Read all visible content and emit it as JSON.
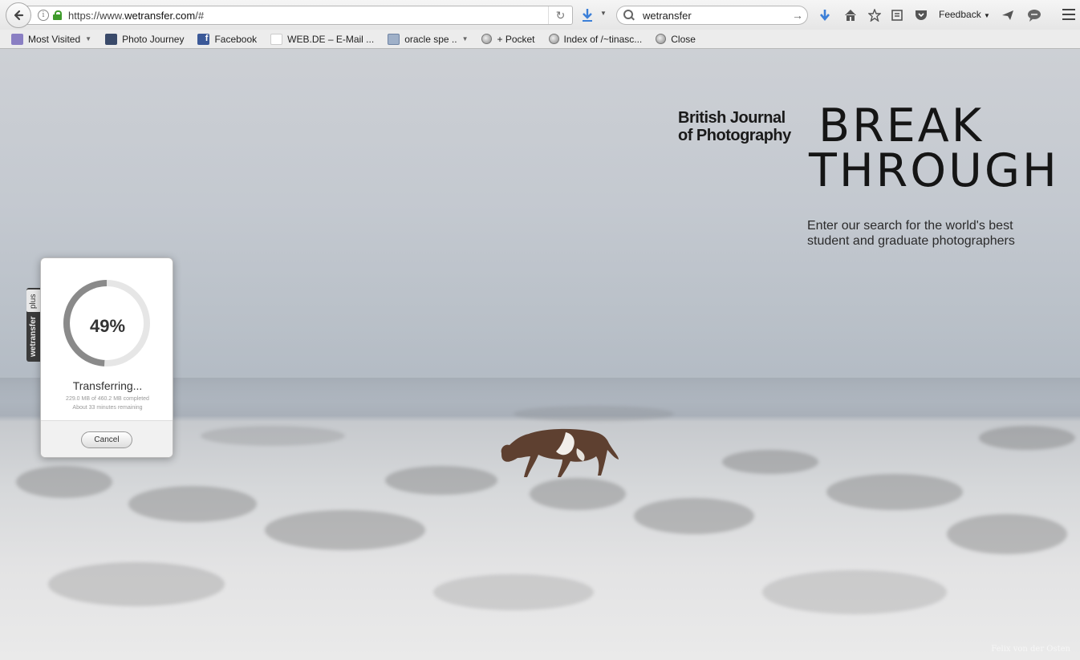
{
  "browser": {
    "url_prefix": "https://www.",
    "url_domain": "wetransfer.com",
    "url_suffix": "/#",
    "search_value": "wetransfer",
    "feedback_label": "Feedback"
  },
  "bookmarks": [
    {
      "label": "Most Visited",
      "icon": "most-visited-icon"
    },
    {
      "label": "Photo Journey",
      "icon": "photo-journey-icon"
    },
    {
      "label": "Facebook",
      "icon": "facebook-icon"
    },
    {
      "label": "WEB.DE – E-Mail ...",
      "icon": "webde-icon"
    },
    {
      "label": "oracle spe ..",
      "icon": "folder-icon"
    },
    {
      "label": "+ Pocket",
      "icon": "globe-icon"
    },
    {
      "label": "Index of /~tinasc...",
      "icon": "globe-icon"
    },
    {
      "label": "Close",
      "icon": "globe-icon"
    }
  ],
  "ad": {
    "bjp_line1": "British Journal",
    "bjp_line2": "of Photography",
    "headline_line1": "BREAK",
    "headline_line2": "THROUGH",
    "tagline_line1": "Enter our search for the world's best",
    "tagline_line2": "student and graduate photographers",
    "photo_credit": "Felix von der Osten"
  },
  "wetransfer_tab": {
    "plus_label": "plus",
    "name_label": "wetransfer"
  },
  "transfer": {
    "percent": 49,
    "percent_label": "49%",
    "status": "Transferring...",
    "completed_text": "229.0 MB of 460.2 MB completed",
    "remaining_text": "About 33 minutes remaining",
    "cancel_label": "Cancel"
  },
  "colors": {
    "ring_progress": "#8a8a8a",
    "ring_track": "#e6e6e6",
    "secure_lock": "#3e9b2b",
    "download_arrow": "#3b7fd8"
  }
}
